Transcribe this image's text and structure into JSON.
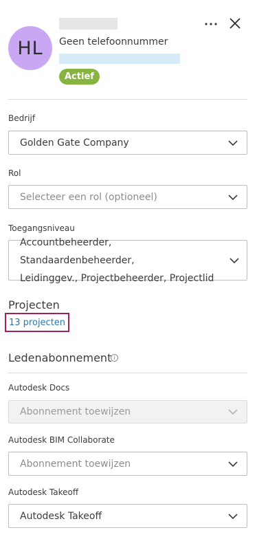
{
  "user": {
    "initials": "HL",
    "phone": "Geen telefoonnummer",
    "status": "Actief"
  },
  "colors": {
    "avatar_bg": "#c9a7f2",
    "status_badge": "#87b340",
    "link": "#2479b2",
    "highlight_border": "#a3205a"
  },
  "header": {
    "more_icon": "ellipsis-icon",
    "close_icon": "close-icon"
  },
  "fields": {
    "company": {
      "label": "Bedrijf",
      "value": "Golden Gate Company"
    },
    "role": {
      "label": "Rol",
      "placeholder": "Selecteer een rol (optioneel)"
    },
    "access": {
      "label": "Toegangsniveau",
      "line1": "Accountbeheerder, Standaardenbeheerder,",
      "line2": "Leidinggev., Projectbeheerder, Projectlid"
    }
  },
  "projects": {
    "title": "Projecten",
    "link": "13 projecten"
  },
  "subscriptions": {
    "title": "Ledenabonnement",
    "info_icon": "info-icon",
    "docs": {
      "label": "Autodesk Docs",
      "placeholder": "Abonnement toewijzen"
    },
    "bim": {
      "label": "Autodesk BIM Collaborate",
      "placeholder": "Abonnement toewijzen"
    },
    "takeoff": {
      "label": "Autodesk Takeoff",
      "value": "Autodesk Takeoff"
    }
  }
}
